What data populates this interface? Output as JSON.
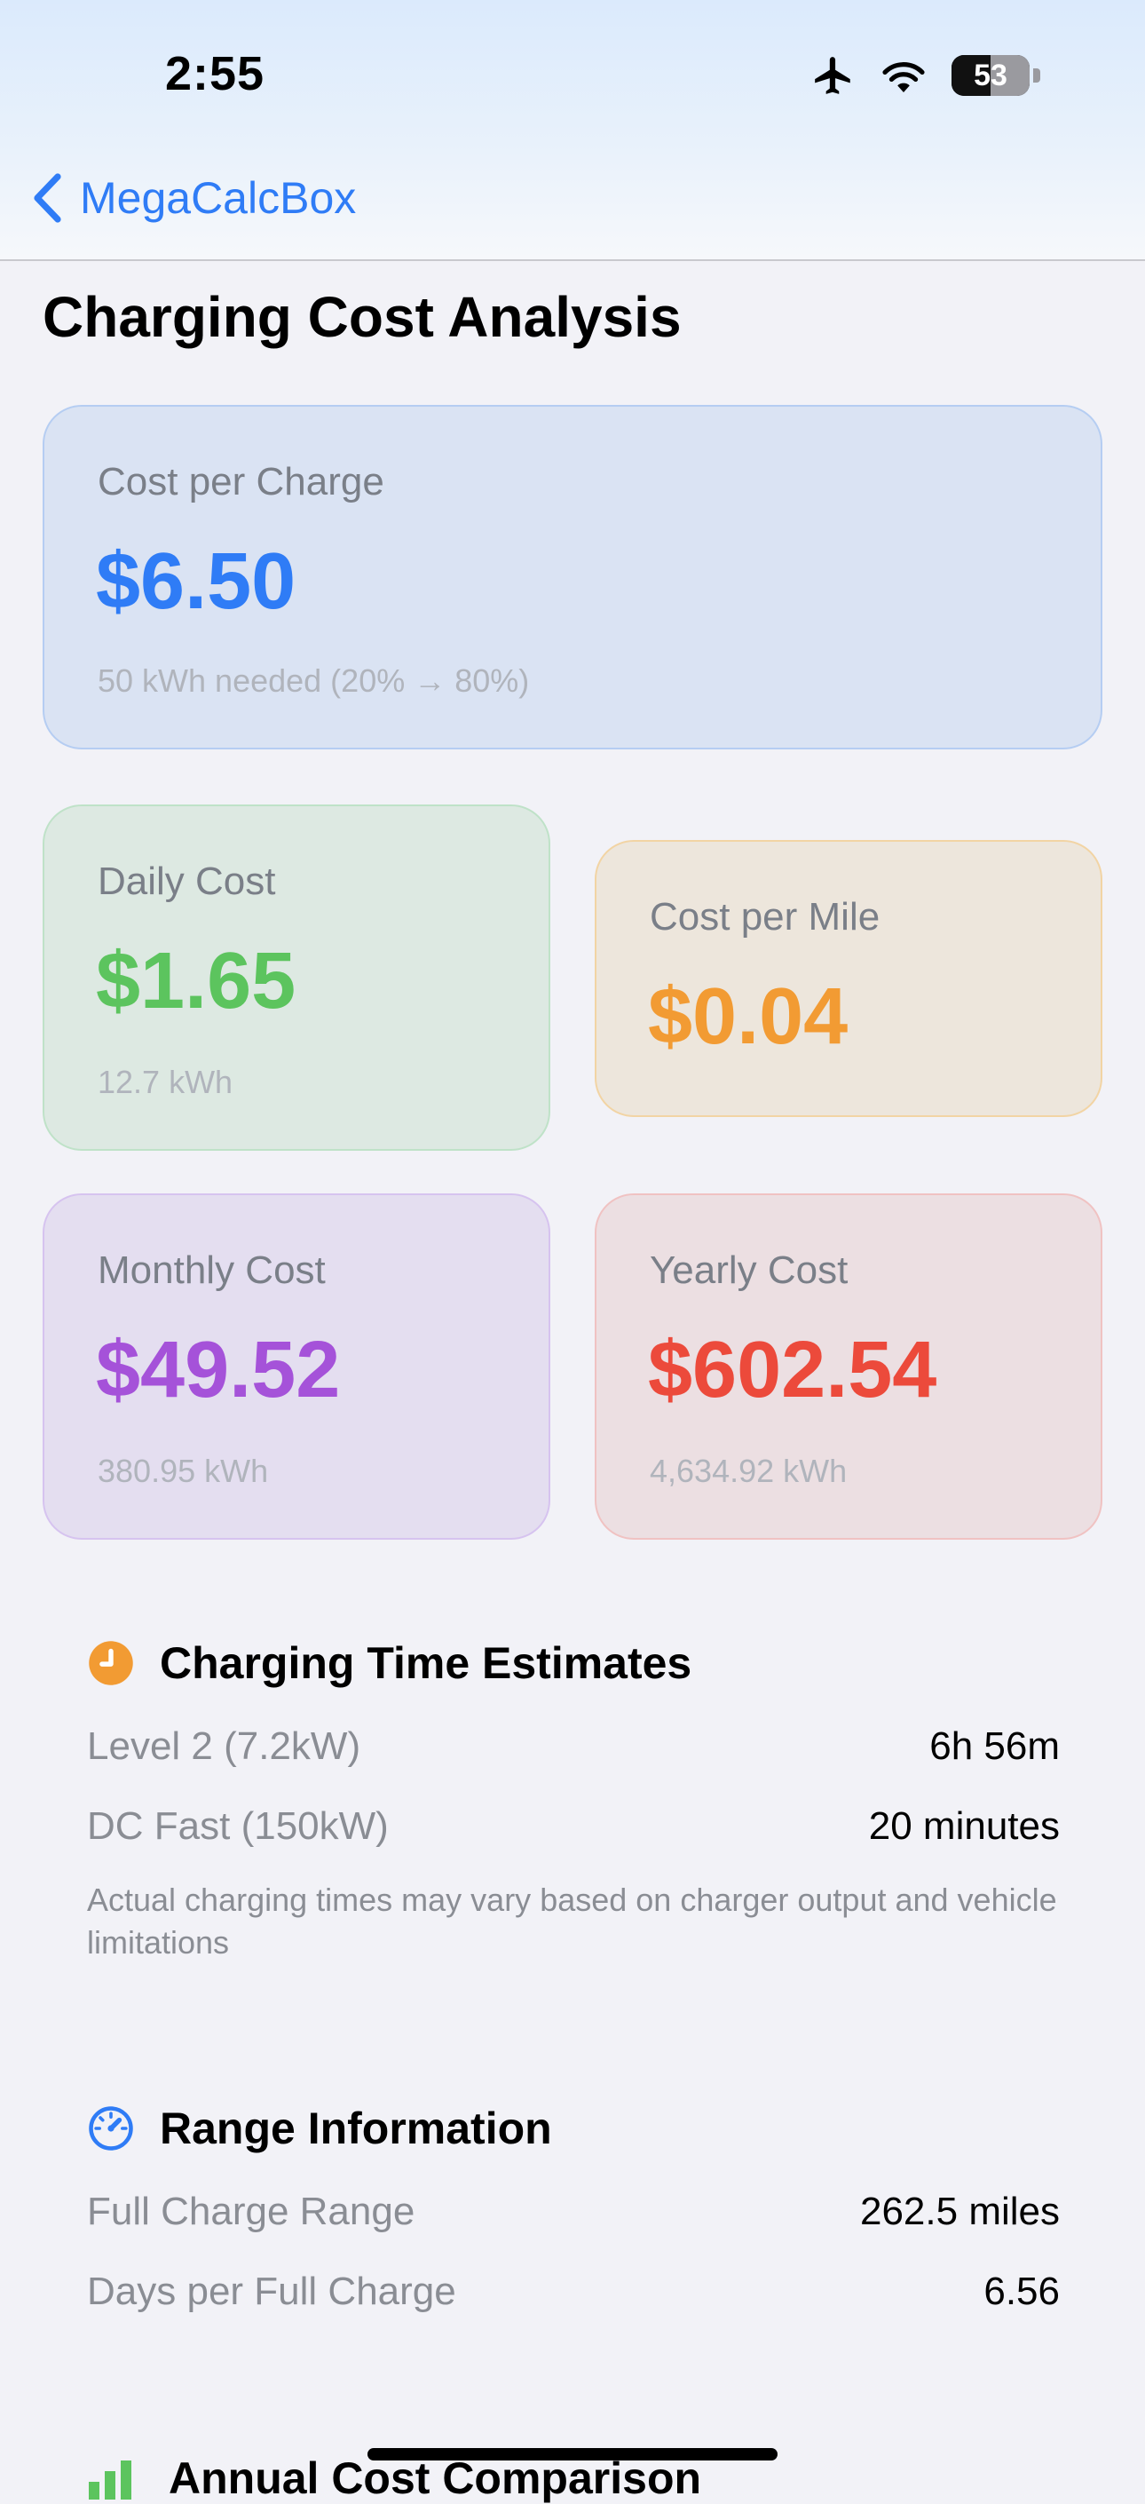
{
  "status_bar": {
    "time": "2:55",
    "battery": "53"
  },
  "nav": {
    "back_label": "MegaCalcBox"
  },
  "page": {
    "title": "Charging Cost Analysis"
  },
  "cards": {
    "per_charge": {
      "label": "Cost per Charge",
      "value": "$6.50",
      "sub": "50 kWh needed (20% → 80%)",
      "color": "#2f7cf6"
    },
    "daily": {
      "label": "Daily Cost",
      "value": "$1.65",
      "sub": "12.7 kWh",
      "color": "#5cc45e"
    },
    "per_mile": {
      "label": "Cost per Mile",
      "value": "$0.04",
      "color": "#f29b33"
    },
    "monthly": {
      "label": "Monthly Cost",
      "value": "$49.52",
      "sub": "380.95 kWh",
      "color": "#a552d9"
    },
    "yearly": {
      "label": "Yearly Cost",
      "value": "$602.54",
      "sub": "4,634.92 kWh",
      "color": "#ec4a3b"
    }
  },
  "charging_time": {
    "title": "Charging Time Estimates",
    "icon": "clock-icon",
    "rows": [
      {
        "label": "Level 2 (7.2kW)",
        "value": "6h 56m"
      },
      {
        "label": "DC Fast (150kW)",
        "value": "20 minutes"
      }
    ],
    "note": "Actual charging times may vary based on charger output and vehicle limitations"
  },
  "range": {
    "title": "Range Information",
    "icon": "speedometer-icon",
    "rows": [
      {
        "label": "Full Charge Range",
        "value": "262.5 miles"
      },
      {
        "label": "Days per Full Charge",
        "value": "6.56"
      }
    ]
  },
  "annual": {
    "title": "Annual Cost Comparison",
    "icon": "bar-chart-icon"
  }
}
